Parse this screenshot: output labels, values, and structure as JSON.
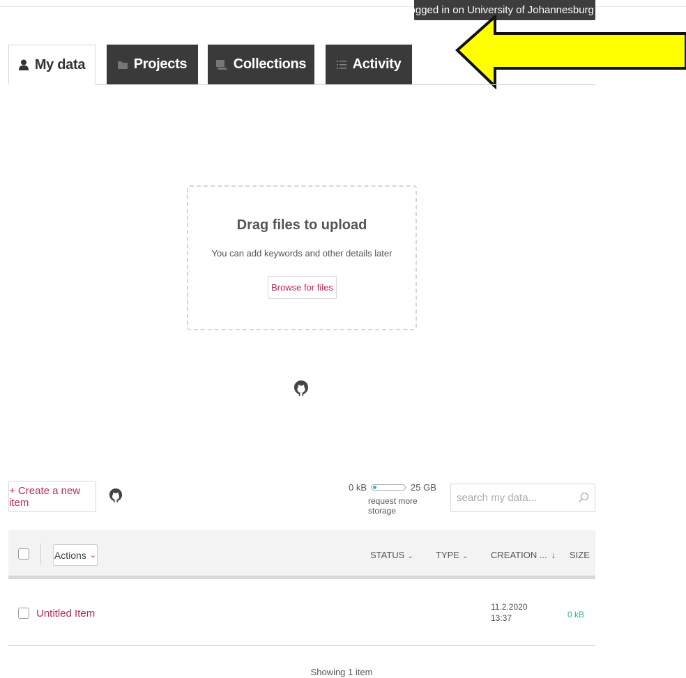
{
  "login_banner": {
    "text": "Logged in on University of Johannesburg",
    "close": "×"
  },
  "tabs": [
    {
      "label": "My data",
      "icon": "user-icon",
      "active": true
    },
    {
      "label": "Projects",
      "icon": "folder-icon",
      "active": false
    },
    {
      "label": "Collections",
      "icon": "collections-icon",
      "active": false
    },
    {
      "label": "Activity",
      "icon": "list-icon",
      "active": false
    }
  ],
  "upload": {
    "title": "Drag files to upload",
    "subtitle": "You can add keywords and other details later",
    "browse_label": "Browse for files"
  },
  "toolbar": {
    "create_label": "+ Create a new item",
    "storage_used": "0 kB",
    "storage_total": "25 GB",
    "storage_fraction": 0.0,
    "storage_link": "request more storage",
    "search_placeholder": "search my data..."
  },
  "table": {
    "actions_label": "Actions",
    "headers": {
      "status": "STATUS",
      "type": "TYPE",
      "creation": "CREATION ...",
      "size": "SIZE"
    },
    "rows": [
      {
        "title": "Untitled Item",
        "date": "11.2.2020",
        "time": "13:37",
        "size": "0 kB"
      }
    ]
  },
  "footer": {
    "showing": "Showing 1 item"
  },
  "colors": {
    "accent": "#b03050",
    "teal": "#29b6a8",
    "dark_tab": "#3a3a3a",
    "arrow_fill": "#ffff00"
  }
}
